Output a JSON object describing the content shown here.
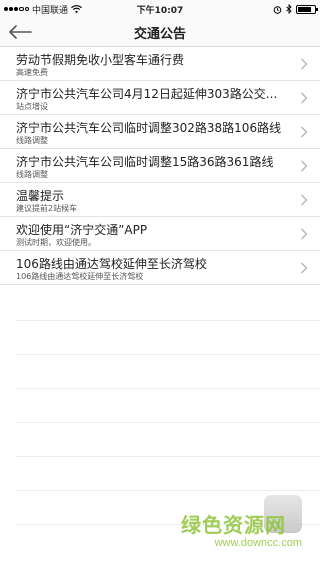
{
  "status_bar": {
    "carrier": "中国联通",
    "time": "下午10:07",
    "battery_icon": "battery-icon"
  },
  "nav": {
    "title": "交通公告",
    "back_icon": "arrow-left-icon"
  },
  "notices": [
    {
      "title": "劳动节假期免收小型客车通行费",
      "subtitle": "高速免费"
    },
    {
      "title": "济宁市公共汽车公司4月12日起延伸303路公交...",
      "subtitle": "站点增设"
    },
    {
      "title": "济宁市公共汽车公司临时调整302路38路106路线",
      "subtitle": "线路调整"
    },
    {
      "title": "济宁市公共汽车公司临时调整15路36路361路线",
      "subtitle": "线路调整"
    },
    {
      "title": "温馨提示",
      "subtitle": "建议提前2站候车"
    },
    {
      "title": "欢迎使用“济宁交通”APP",
      "subtitle": "测试时期，欢迎使用。"
    },
    {
      "title": "106路线由通达驾校延伸至长济驾校",
      "subtitle": "106路线由通达驾校延伸至长济驾校"
    }
  ],
  "watermark": {
    "text": "绿色资源网",
    "url": "www.downcc.com"
  }
}
